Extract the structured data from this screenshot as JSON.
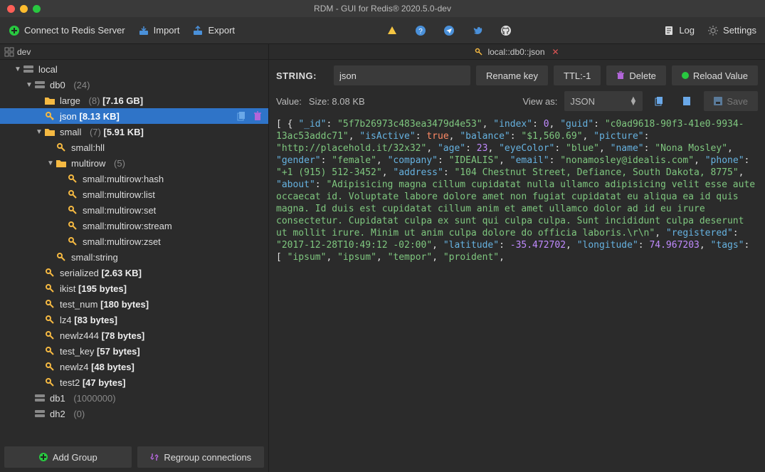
{
  "window": {
    "title": "RDM - GUI for Redis® 2020.5.0-dev"
  },
  "toolbar": {
    "connect": "Connect to Redis Server",
    "import": "Import",
    "export": "Export",
    "log": "Log",
    "settings": "Settings"
  },
  "breadcrumb": {
    "root": "dev"
  },
  "tree": {
    "local": "local",
    "db0": {
      "name": "db0",
      "count": "(24)"
    },
    "large": {
      "name": "large",
      "count": "(8)",
      "size": "[7.16 GB]"
    },
    "json": {
      "name": "json",
      "size": "[8.13 KB]"
    },
    "small": {
      "name": "small",
      "count": "(7)",
      "size": "[5.91 KB]"
    },
    "small_hll": "small:hll",
    "multirow": {
      "name": "multirow",
      "count": "(5)"
    },
    "mr_hash": "small:multirow:hash",
    "mr_list": "small:multirow:list",
    "mr_set": "small:multirow:set",
    "mr_stream": "small:multirow:stream",
    "mr_zset": "small:multirow:zset",
    "small_string": "small:string",
    "serialized": {
      "name": "serialized",
      "size": "[2.63 KB]"
    },
    "ikist": {
      "name": "ikist",
      "size": "[195 bytes]"
    },
    "test_num": {
      "name": "test_num",
      "size": "[180 bytes]"
    },
    "lz4": {
      "name": "lz4",
      "size": "[83 bytes]"
    },
    "newlz444": {
      "name": "newlz444",
      "size": "[78 bytes]"
    },
    "test_key": {
      "name": "test_key",
      "size": "[57 bytes]"
    },
    "newlz4": {
      "name": "newlz4",
      "size": "[48 bytes]"
    },
    "test2": {
      "name": "test2",
      "size": "[47 bytes]"
    },
    "db1": {
      "name": "db1",
      "count": "(1000000)"
    },
    "db2": {
      "name": "dh2",
      "count": "(0)"
    }
  },
  "bottom": {
    "add_group": "Add Group",
    "regroup": "Regroup connections"
  },
  "tab": {
    "path": "local::db0::json"
  },
  "keybar": {
    "type_label": "STRING:",
    "key_value": "json",
    "rename": "Rename key",
    "ttl": "TTL:-1",
    "delete": "Delete",
    "reload": "Reload Value"
  },
  "valuebar": {
    "value_label": "Value:",
    "size_label": "Size: 8.08 KB",
    "view_as": "View as:",
    "formatter": "JSON",
    "save": "Save"
  },
  "json_value": {
    "_id": "5f7b26973c483ea3479d4e53",
    "index": 0,
    "guid": "c0ad9618-90f3-41e0-9934-13ac53addc71",
    "isActive": true,
    "balance": "$1,560.69",
    "picture": "http://placehold.it/32x32",
    "age": 23,
    "eyeColor": "blue",
    "name": "Nona Mosley",
    "gender": "female",
    "company": "IDEALIS",
    "email": "nonamosley@idealis.com",
    "phone": "+1 (915) 512-3452",
    "address": "104 Chestnut Street, Defiance, South Dakota, 8775",
    "about": "Adipisicing magna cillum cupidatat nulla ullamco adipisicing velit esse aute occaecat id. Voluptate labore dolore amet non fugiat cupidatat eu aliqua ea id quis magna. Id duis est cupidatat cillum anim et amet ullamco dolor ad id eu irure consectetur. Cupidatat culpa ex sunt qui culpa culpa. Sunt incididunt culpa deserunt ut mollit irure. Minim ut anim culpa dolore do officia laboris.\\r\\n",
    "registered": "2017-12-28T10:49:12 -02:00",
    "latitude": -35.472702,
    "longitude": 74.967203,
    "tags": [
      "ipsum",
      "ipsum",
      "tempor",
      "proident"
    ]
  }
}
